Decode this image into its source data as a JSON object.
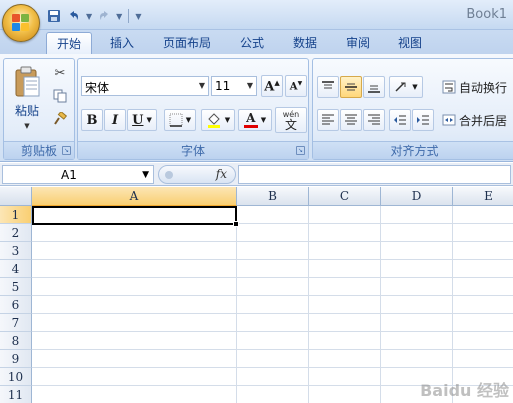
{
  "window": {
    "title": "Book1"
  },
  "quick_access": {
    "save_icon": "save-icon",
    "undo_icon": "undo-icon",
    "redo_icon": "redo-icon",
    "customize_icon": "dropdown-icon"
  },
  "tabs": [
    {
      "label": "开始",
      "active": true
    },
    {
      "label": "插入"
    },
    {
      "label": "页面布局"
    },
    {
      "label": "公式"
    },
    {
      "label": "数据"
    },
    {
      "label": "审阅"
    },
    {
      "label": "视图"
    }
  ],
  "clipboard": {
    "paste_label": "粘贴",
    "group_label": "剪贴板"
  },
  "font": {
    "name": "宋体",
    "size": "11",
    "group_label": "字体",
    "bold": "B",
    "italic": "I",
    "underline": "U",
    "grow": "A",
    "shrink": "A",
    "font_color_letter": "A",
    "wen_top": "wén",
    "wen": "文"
  },
  "alignment": {
    "wrap_label": "自动换行",
    "merge_label": "合并后居",
    "group_label": "对齐方式"
  },
  "formula_bar": {
    "name_box": "A1",
    "fx": "fx",
    "content": ""
  },
  "columns": [
    "A",
    "B",
    "C",
    "D",
    "E"
  ],
  "rows": [
    "1",
    "2",
    "3",
    "4",
    "5",
    "6",
    "7",
    "8",
    "9",
    "10",
    "11"
  ],
  "active_cell": "A1",
  "colors": {
    "accent": "#15428b",
    "header_active": "#f9cf72",
    "ribbon": "#dce8f7"
  },
  "watermark": "Baidu 经验"
}
